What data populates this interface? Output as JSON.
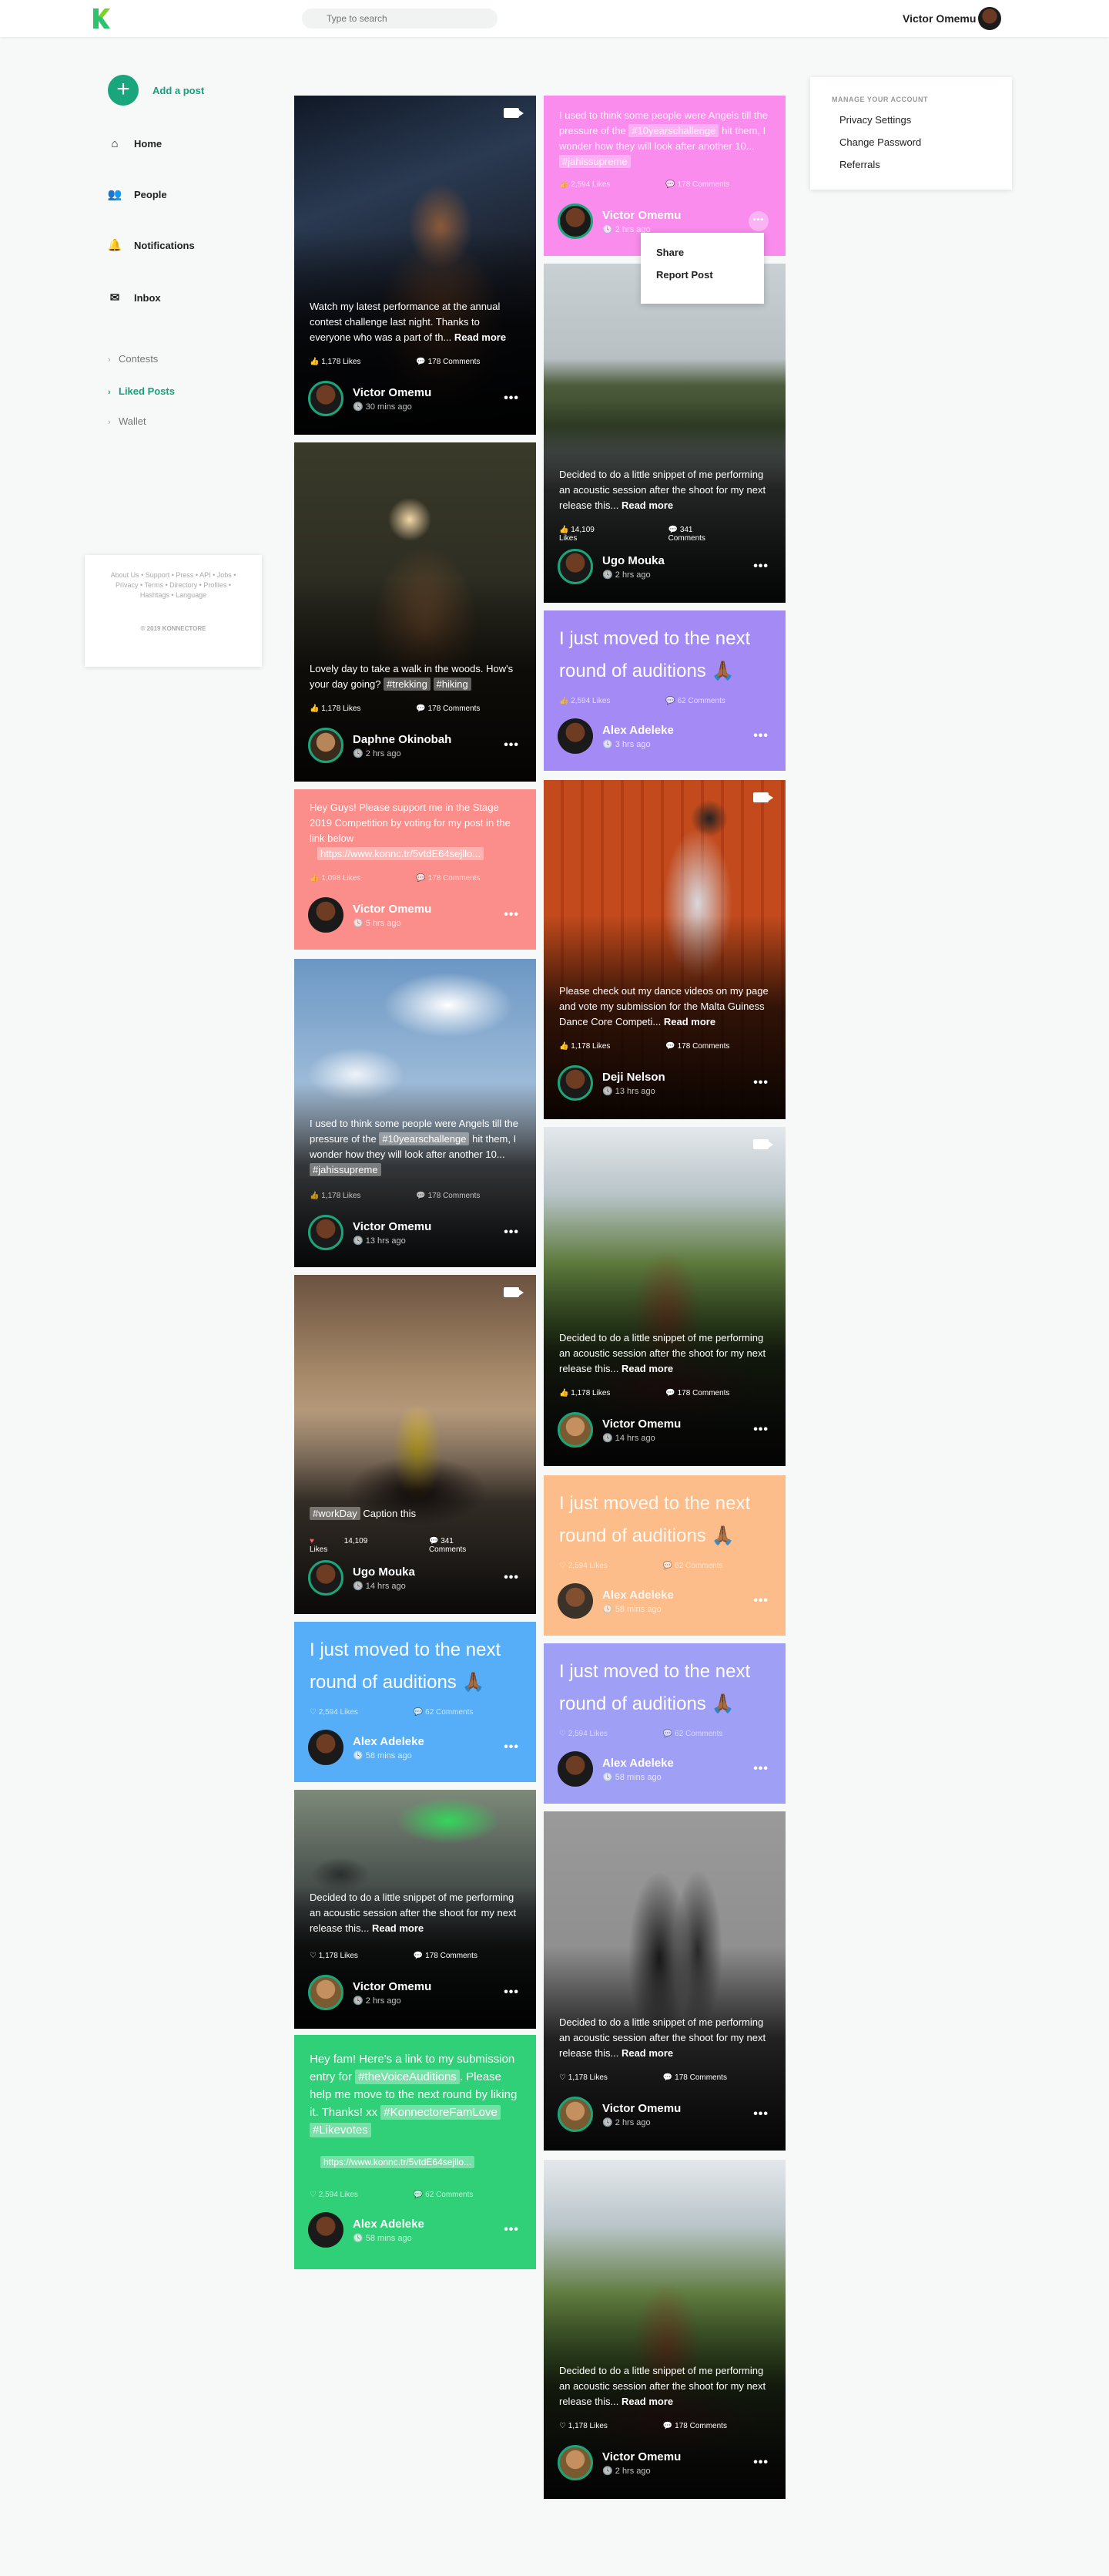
{
  "header": {
    "search_placeholder": "Type to search",
    "user_name": "Victor Omemu",
    "brand_color": "#1ba57a"
  },
  "sidebar": {
    "add_post": "Add a post",
    "nav": [
      {
        "label": "Home",
        "icon": "home-icon"
      },
      {
        "label": "People",
        "icon": "people-icon"
      },
      {
        "label": "Notifications",
        "icon": "bell-icon"
      },
      {
        "label": "Inbox",
        "icon": "inbox-icon"
      }
    ],
    "sub": [
      {
        "label": "Contests",
        "active": false
      },
      {
        "label": "Liked Posts",
        "active": true
      },
      {
        "label": "Wallet",
        "active": false
      }
    ],
    "footer_links": "About Us • Support • Press • API • Jobs • Privacy • Terms • Directory • Profiles • Hashtags • Language",
    "copyright": "© 2019 KONNECTORE"
  },
  "account": {
    "title": "MANAGE YOUR ACCOUNT",
    "links": [
      "Privacy Settings",
      "Change Password",
      "Referrals"
    ]
  },
  "popup": {
    "share": "Share",
    "report": "Report Post"
  },
  "more": "•••",
  "read_more": "Read more",
  "posts": {
    "p1": {
      "caption": "Watch my latest performance at the annual contest challenge last night. Thanks to everyone who was a part of th...",
      "likes": "1,178 Likes",
      "comments": "178 Comments",
      "name": "Victor Omemu",
      "time": "30 mins ago"
    },
    "p2": {
      "caption": "Lovely day to take a walk in the woods. How's your day going?",
      "tag1": "#trekking",
      "tag2": "#hiking",
      "likes": "1,178 Likes",
      "comments": "178 Comments",
      "name": "Daphne Okinobah",
      "time": "2 hrs ago"
    },
    "p3": {
      "caption": "Hey Guys! Please support me in the Stage 2019 Competition by voting for my post in the link below",
      "link": "https://www.konnc.tr/5vtdE64sejllo...",
      "likes": "1,098 Likes",
      "comments": "178 Comments",
      "name": "Victor Omemu",
      "time": "5 hrs ago"
    },
    "p4": {
      "caption1": "I used to think some people were Angels till the pressure of the",
      "tag1": "#10yearschallenge",
      "caption2": "hit them, I wonder how they will look after another 10...",
      "tag2": "#jahissupreme",
      "likes": "1,178 Likes",
      "comments": "178 Comments",
      "name": "Victor Omemu",
      "time": "13 hrs ago"
    },
    "p5": {
      "tag": "#workDay",
      "caption": "Caption this",
      "likes": "14,109 Likes",
      "comments": "341 Comments",
      "name": "Ugo Mouka",
      "time": "14 hrs ago"
    },
    "p6": {
      "text": "I just moved to the next round of auditions 🙏🏾",
      "likes": "2,594 Likes",
      "comments": "62 Comments",
      "name": "Alex Adeleke",
      "time": "58 mins ago"
    },
    "p7": {
      "caption": "Decided to do a little snippet of me performing an acoustic session after the shoot for my next release this...",
      "likes": "1,178 Likes",
      "comments": "178 Comments",
      "name": "Victor Omemu",
      "time": "2 hrs ago"
    },
    "p8": {
      "c1": "Hey fam! Here's a link to my submission entry for",
      "tag1": "#theVoiceAuditions",
      "c2": ". Please help me move to the next round by liking it. Thanks! xx",
      "tag2": "#KonnectoreFamLove",
      "tag3": "#Likevotes",
      "link": "https://www.konnc.tr/5vtdE64sejllo...",
      "likes": "2,594 Likes",
      "comments": "62 Comments",
      "name": "Alex Adeleke",
      "time": "58 mins ago"
    },
    "q1": {
      "caption1": "I used to think some people were Angels till the pressure of the",
      "tag1": "#10yearschallenge",
      "caption2": "hit them, I wonder how they will look after another 10...",
      "tag2": "#jahissupreme",
      "likes": "2,594 Likes",
      "comments": "178 Comments",
      "name": "Victor Omemu",
      "time": "2 hrs ago"
    },
    "q2": {
      "caption": "Decided to do a little snippet of me performing an acoustic session after the shoot for my next release this...",
      "likes": "14,109 Likes",
      "comments": "341 Comments",
      "name": "Ugo Mouka",
      "time": "2 hrs ago"
    },
    "q3": {
      "text": "I just moved to the next round of auditions 🙏🏾",
      "likes": "2,594 Likes",
      "comments": "62 Comments",
      "name": "Alex Adeleke",
      "time": "3 hrs ago"
    },
    "q4": {
      "caption": "Please check out my dance videos on my page and vote my submission for the Malta Guiness Dance Core Competi...",
      "likes": "1,178 Likes",
      "comments": "178 Comments",
      "name": "Deji Nelson",
      "time": "13 hrs ago"
    },
    "q5": {
      "caption": "Decided to do a little snippet of me performing an acoustic session after the shoot for my next release this...",
      "likes": "1,178 Likes",
      "comments": "178 Comments",
      "name": "Victor Omemu",
      "time": "14 hrs ago"
    },
    "q6": {
      "text": "I just moved to the next round of auditions 🙏🏾",
      "likes": "2,594 Likes",
      "comments": "62 Comments",
      "name": "Alex Adeleke",
      "time": "58 mins ago"
    },
    "q7": {
      "text": "I just moved to the next round of auditions 🙏🏾",
      "likes": "2,594 Likes",
      "comments": "62 Comments",
      "name": "Alex Adeleke",
      "time": "58 mins ago"
    },
    "q8": {
      "caption": "Decided to do a little snippet of me performing an acoustic session after the shoot for my next release this...",
      "likes": "1,178 Likes",
      "comments": "178 Comments",
      "name": "Victor Omemu",
      "time": "2 hrs ago"
    },
    "q9": {
      "caption": "Decided to do a little snippet of me performing an acoustic session after the shoot for my next release this...",
      "likes": "1,178 Likes",
      "comments": "178 Comments",
      "name": "Victor Omemu",
      "time": "2 hrs ago"
    }
  }
}
